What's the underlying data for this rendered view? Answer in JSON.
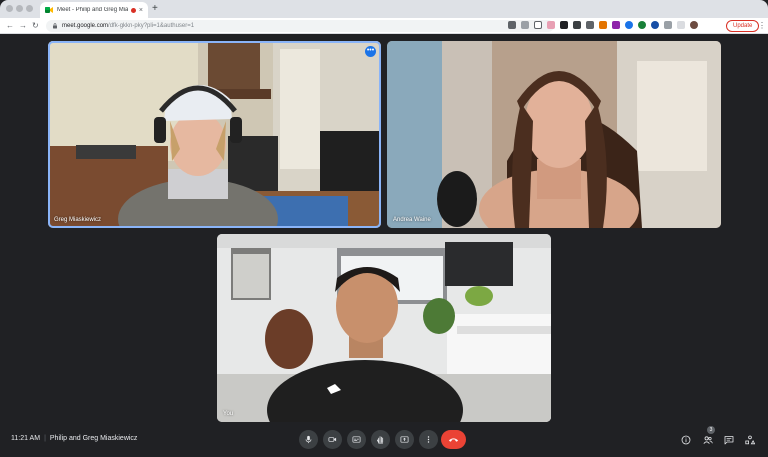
{
  "browser": {
    "tab_title": "Meet - Philip and Greg Mia",
    "new_tab": "+",
    "tab_close": "×",
    "url_main": "meet.google.com",
    "url_rest": "/dfk-gkkn-pky?pli=1&authuser=1",
    "update_label": "Update",
    "nav": {
      "back": "←",
      "forward": "→",
      "reload": "↻"
    },
    "menu": "⋮"
  },
  "participants": [
    {
      "name": "Greg Miaskiewicz",
      "active": true
    },
    {
      "name": "Andrea Waine",
      "active": false
    },
    {
      "name": "You",
      "active": false
    }
  ],
  "tile_more": "•••",
  "meeting": {
    "time": "11:21 AM",
    "separator": "|",
    "title": "Philip and Greg Miaskiewicz",
    "people_count": "3"
  },
  "icons": {
    "mic": "mic-icon",
    "camera": "camera-icon",
    "captions": "captions-icon",
    "raise_hand": "raise-hand-icon",
    "present": "present-screen-icon",
    "more": "more-options-icon",
    "end_call": "end-call-icon",
    "info": "info-icon",
    "people": "people-icon",
    "chat": "chat-icon",
    "activities": "activities-icon"
  },
  "colors": {
    "background": "#202124",
    "control": "#3c4043",
    "end_call": "#ea4335",
    "active_outline": "#8ab4f8",
    "accent": "#1a73e8"
  }
}
